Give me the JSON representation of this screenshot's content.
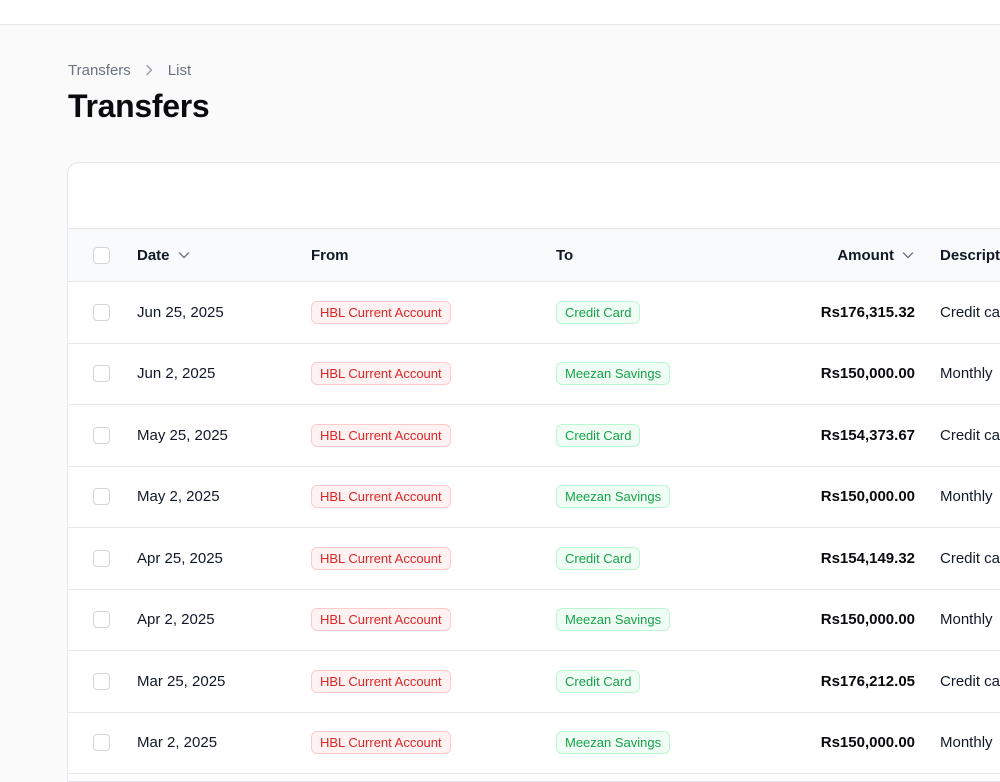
{
  "breadcrumb": {
    "root": "Transfers",
    "current": "List"
  },
  "page": {
    "title": "Transfers"
  },
  "table": {
    "headers": {
      "date": "Date",
      "from": "From",
      "to": "To",
      "amount": "Amount",
      "description": "Descript"
    },
    "rows": [
      {
        "date": "Jun 25, 2025",
        "from": "HBL Current Account",
        "to": "Credit Card",
        "amount": "Rs176,315.32",
        "description": "Credit ca"
      },
      {
        "date": "Jun 2, 2025",
        "from": "HBL Current Account",
        "to": "Meezan Savings",
        "amount": "Rs150,000.00",
        "description": "Monthly"
      },
      {
        "date": "May 25, 2025",
        "from": "HBL Current Account",
        "to": "Credit Card",
        "amount": "Rs154,373.67",
        "description": "Credit ca"
      },
      {
        "date": "May 2, 2025",
        "from": "HBL Current Account",
        "to": "Meezan Savings",
        "amount": "Rs150,000.00",
        "description": "Monthly"
      },
      {
        "date": "Apr 25, 2025",
        "from": "HBL Current Account",
        "to": "Credit Card",
        "amount": "Rs154,149.32",
        "description": "Credit ca"
      },
      {
        "date": "Apr 2, 2025",
        "from": "HBL Current Account",
        "to": "Meezan Savings",
        "amount": "Rs150,000.00",
        "description": "Monthly"
      },
      {
        "date": "Mar 25, 2025",
        "from": "HBL Current Account",
        "to": "Credit Card",
        "amount": "Rs176,212.05",
        "description": "Credit ca"
      },
      {
        "date": "Mar 2, 2025",
        "from": "HBL Current Account",
        "to": "Meezan Savings",
        "amount": "Rs150,000.00",
        "description": "Monthly"
      }
    ]
  },
  "colors": {
    "from_badge_text": "#dc2626",
    "to_badge_text": "#16a34a",
    "page_background": "#fafafa"
  },
  "icons": {
    "breadcrumb_separator": "chevron-right-icon",
    "sort": "chevron-down-icon"
  }
}
